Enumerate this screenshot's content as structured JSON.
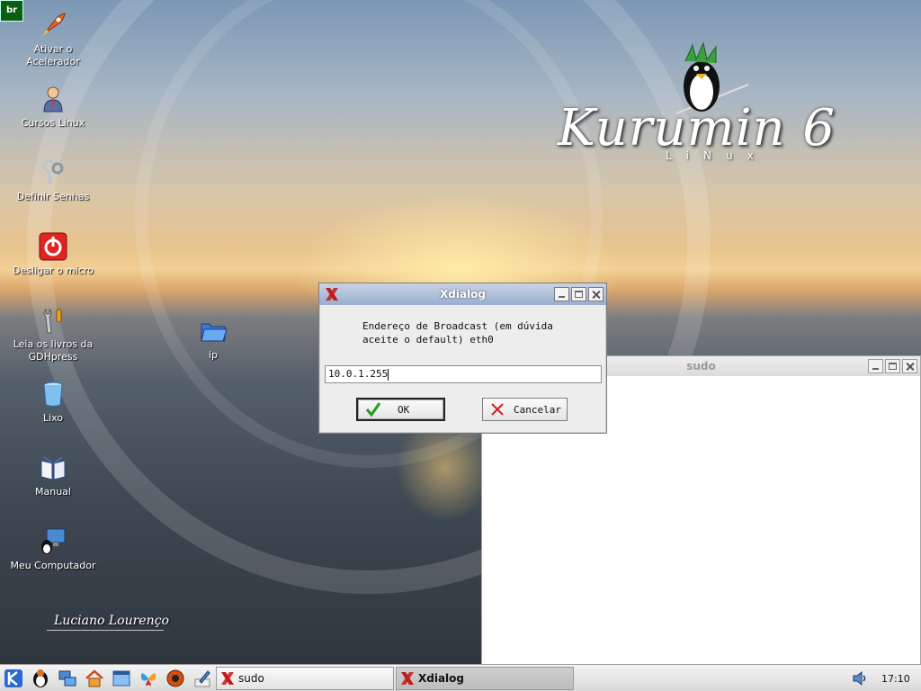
{
  "desktop": {
    "badge": "br",
    "icons": [
      {
        "label_line1": "Ativar o",
        "label_line2": "Acelerador",
        "icon": "rocket-icon"
      },
      {
        "label_line1": "Cursos Linux",
        "label_line2": "",
        "icon": "user-icon"
      },
      {
        "label_line1": "Definir Senhas",
        "label_line2": "",
        "icon": "keys-icon"
      },
      {
        "label_line1": "Desligar o micro",
        "label_line2": "",
        "icon": "power-icon"
      },
      {
        "label_line1": "Leia os livros da",
        "label_line2": "GDHpress",
        "icon": "tools-icon"
      },
      {
        "label_line1": "Lixo",
        "label_line2": "",
        "icon": "trash-icon"
      },
      {
        "label_line1": "Manual",
        "label_line2": "",
        "icon": "book-icon"
      },
      {
        "label_line1": "Meu Computador",
        "label_line2": "",
        "icon": "computer-icon"
      },
      {
        "label_line1": "ip",
        "label_line2": "",
        "icon": "folder-icon"
      }
    ],
    "logo_text": "Kurumin 6",
    "logo_sub": "LiNux",
    "signature": "Luciano Lourenço"
  },
  "sudo_window": {
    "title": "sudo"
  },
  "xdialog": {
    "title": "Xdialog",
    "message_line1": "Endereço de Broadcast (em dúvida",
    "message_line2": "aceite o default) eth0",
    "input_value": "10.0.1.255",
    "ok_label": "OK",
    "cancel_label": "Cancelar"
  },
  "taskbar": {
    "launchers": [
      "kde-menu-icon",
      "tux-icon",
      "network-icon",
      "home-icon",
      "window-icon",
      "butterfly-icon",
      "media-icon",
      "edit-icon"
    ],
    "tasks": [
      {
        "label": "sudo",
        "active": false
      },
      {
        "label": "Xdialog",
        "active": true
      }
    ],
    "clock": "17:10"
  },
  "colors": {
    "titlebar_active": "#9aaed0",
    "titlebar_inactive": "#dcdcdc",
    "ok_check": "#2a9a1a",
    "cancel_x": "#d42020",
    "x_logo": "#c41a1a"
  }
}
